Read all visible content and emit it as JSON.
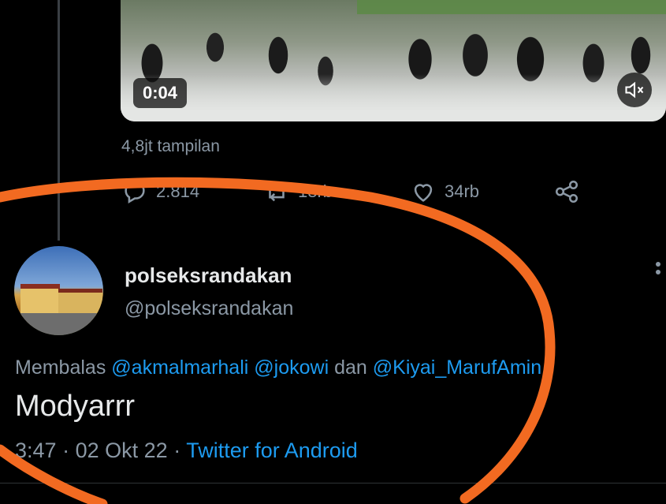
{
  "video": {
    "duration": "0:04",
    "mute_icon": "volume-mute-icon"
  },
  "stats": {
    "views": "4,8jt tampilan"
  },
  "actions": {
    "reply": {
      "icon": "reply-icon",
      "count": "2.814"
    },
    "retweet": {
      "icon": "retweet-icon",
      "count": "18rb"
    },
    "like": {
      "icon": "heart-icon",
      "count": "34rb"
    },
    "share": {
      "icon": "share-icon"
    }
  },
  "reply_tweet": {
    "display_name": "polseksrandakan",
    "handle": "@polseksrandakan",
    "replying_prefix": "Membalas",
    "mentions": [
      "@akmalmarhali",
      "@jokowi",
      "@Kiyai_MarufAmin"
    ],
    "mention_joiner": "dan",
    "text": "Modyarrr",
    "time": "3:47",
    "date": "02 Okt 22",
    "source": "Twitter for Android"
  },
  "colors": {
    "accent": "#1d9bf0",
    "muted": "#8b98a5",
    "annotation": "#f26a21"
  }
}
